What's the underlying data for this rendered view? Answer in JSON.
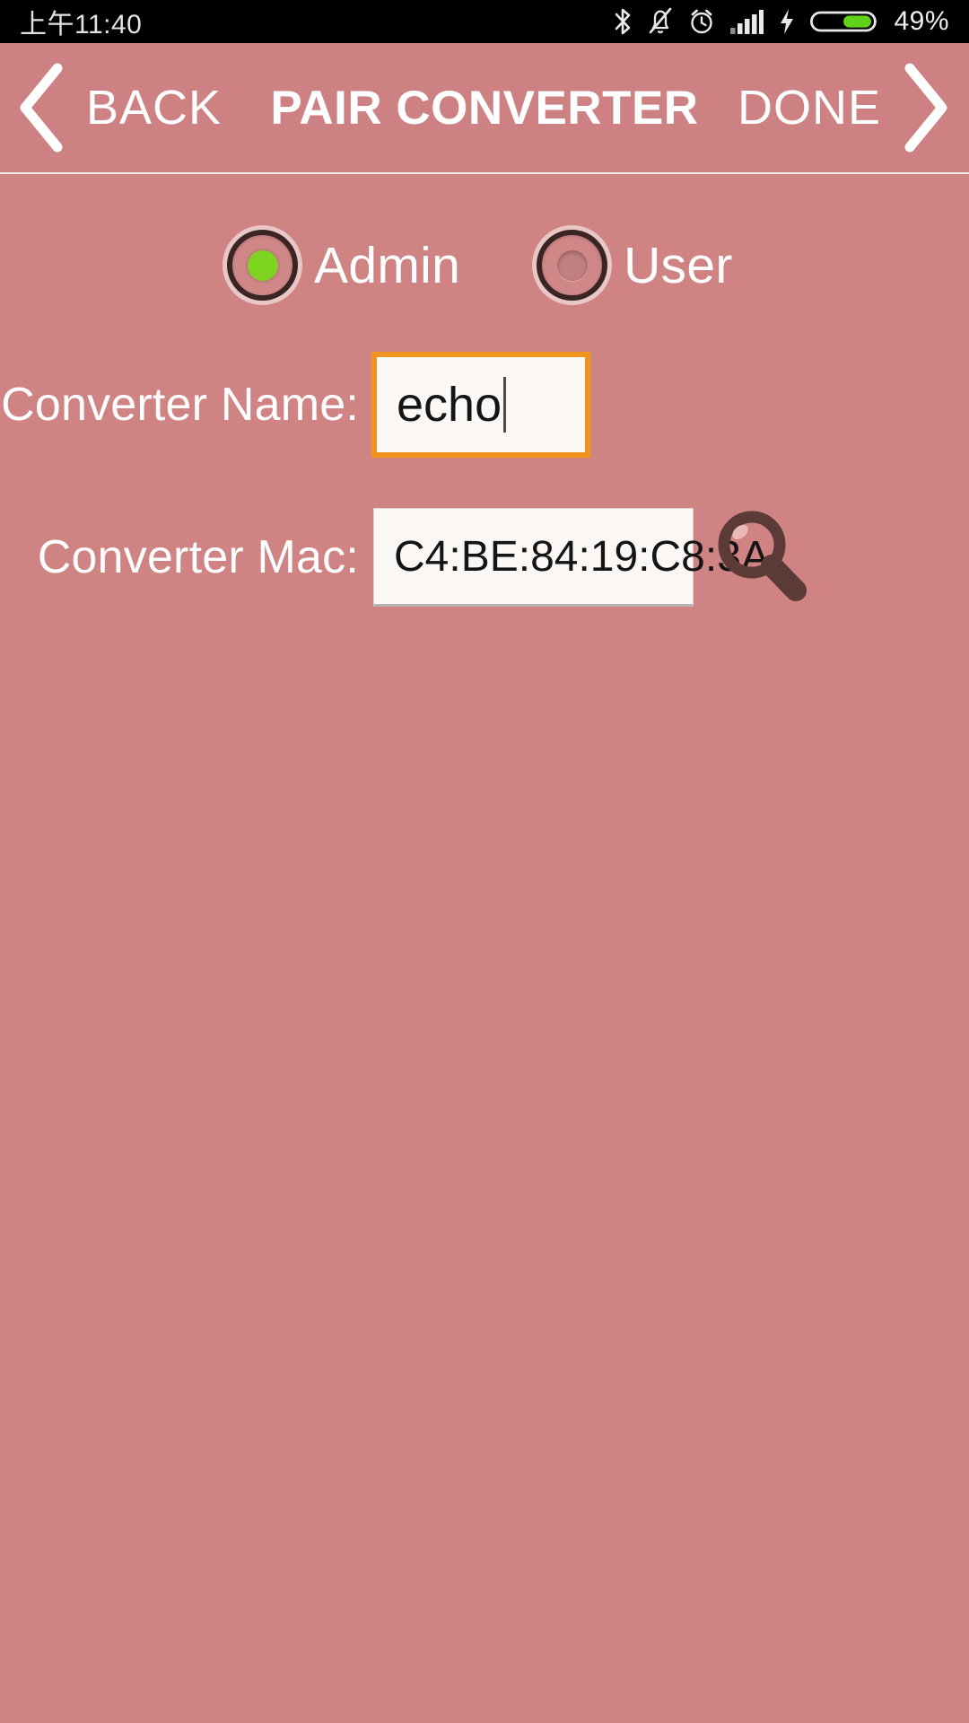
{
  "status_bar": {
    "time": "上午11:40",
    "battery_percent": "49%",
    "icons": [
      "bluetooth-icon",
      "bell-muted-icon",
      "alarm-clock-icon",
      "signal-bars-icon",
      "charging-bolt-icon",
      "battery-icon"
    ],
    "battery_level": 49,
    "battery_fill_color": "#5fd31a",
    "background_color": "#000000",
    "text_color": "#e6e6e6"
  },
  "header": {
    "back_label": "BACK",
    "title": "PAIR CONVERTER",
    "done_label": "DONE",
    "back_icon": "chevron-left-icon",
    "done_icon": "chevron-right-icon",
    "background_color": "#cd8182",
    "text_color": "#ffffff"
  },
  "form": {
    "role": {
      "options": [
        {
          "label": "Admin",
          "selected": true
        },
        {
          "label": "User",
          "selected": false
        }
      ],
      "selected_color": "#7ed321"
    },
    "converter_name": {
      "label": "Converter Name:",
      "value": "echo",
      "placeholder": "",
      "focused": true,
      "focus_border_color": "#f0941e"
    },
    "converter_mac": {
      "label": "Converter Mac:",
      "value": "C4:BE:84:19:C8:3A",
      "placeholder": "",
      "focused": false
    },
    "search_icon": "magnifier-icon",
    "search_icon_color": "#5c3a38"
  },
  "page": {
    "background_color": "#cf8383"
  }
}
